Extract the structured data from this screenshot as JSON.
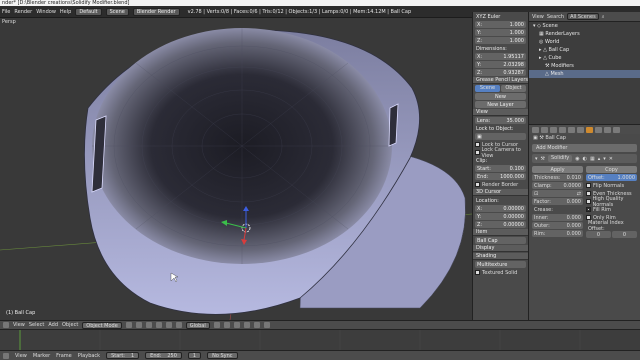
{
  "window": {
    "title": "nder* [D:\\Blender creations\\Solidify Modifier.blend]"
  },
  "infobar": {
    "menus": [
      "File",
      "Render",
      "Window",
      "Help"
    ],
    "layout": "Default",
    "scene": "Scene",
    "engine": "Blender Render",
    "stats": "v2.78 | Verts:0/8 | Faces:0/6 | Tris:0/12 | Objects:1/3 | Lamps:0/0 | Mem:14.12M | Ball Cap"
  },
  "viewport": {
    "label": "Persp",
    "object_name": "(1) Ball Cap"
  },
  "npanel": {
    "xyz_euler": "XYZ Euler",
    "rotation": [
      [
        "X:",
        "1.000"
      ],
      [
        "Y:",
        "1.000"
      ],
      [
        "Z:",
        "1.000"
      ]
    ],
    "dimensions_label": "Dimensions:",
    "dimensions": [
      [
        "X:",
        "1.95117"
      ],
      [
        "Y:",
        "2.03298"
      ],
      [
        "Z:",
        "0.93287"
      ]
    ],
    "grease_pencil": "Grease Pencil Layers",
    "gp_tabs": [
      "Scene",
      "Object"
    ],
    "new_button": "New",
    "new_layer_button": "New Layer",
    "view_header": "View",
    "lens_label": "Lens:",
    "lens_value": "35.000",
    "lock_to_object": "Lock to Object:",
    "lock_to_cursor": "Lock to Cursor",
    "lock_camera": "Lock Camera to View",
    "clip_label": "Clip:",
    "clip_start_label": "Start:",
    "clip_start": "0.100",
    "clip_end_label": "End:",
    "clip_end": "1000.000",
    "render_border": "Render Border",
    "cursor_header": "3D Cursor",
    "location_label": "Location:",
    "cursor": [
      [
        "X:",
        "0.00000"
      ],
      [
        "Y:",
        "0.00000"
      ],
      [
        "Z:",
        "0.00000"
      ]
    ],
    "item_header": "Item",
    "item_name": "Ball Cap",
    "display_header": "Display",
    "shading_header": "Shading",
    "multitexture": "Multitexture",
    "textured_solid": "Textured Solid"
  },
  "outliner": {
    "view": "View",
    "search": "Search",
    "scenes": "All Scenes",
    "items": [
      "Scene",
      "RenderLayers",
      "World",
      "Ball Cap",
      "Cube",
      "Modifiers",
      "Mesh"
    ]
  },
  "properties": {
    "path": "Ball Cap",
    "add_modifier": "Add Modifier",
    "modifier_name": "Solidify",
    "left": {
      "apply": "Apply",
      "thickness_label": "Thickness:",
      "thickness": "0.010",
      "clamp_label": "Clamp:",
      "clamp": "0.0000",
      "offset_label": "Offset:",
      "offset": "1",
      "factor_label": "Factor:",
      "factor": "0.000",
      "crease_label": "Crease:",
      "inner_label": "Inner:",
      "inner": "0.000",
      "outer_label": "Outer:",
      "outer": "0.000",
      "rim_label": "Rim:",
      "rim": "0.000"
    },
    "right": {
      "copy": "Copy",
      "offset_label": "Offset:",
      "offset": "1.0000",
      "flip_normals": "Flip Normals",
      "even_thickness": "Even Thickness",
      "high_quality": "High Quality Normals",
      "fill_rim": "Fill Rim",
      "only_rim": "Only Rim",
      "material_offset": "Material Index Offset:",
      "mat_a": "0",
      "mat_b": "0"
    }
  },
  "vpheader": {
    "menus": [
      "View",
      "Select",
      "Add",
      "Object"
    ],
    "mode": "Object Mode",
    "orientation": "Global"
  },
  "timeline": {
    "menus": [
      "View",
      "Marker",
      "Frame",
      "Playback"
    ],
    "start_label": "Start:",
    "start": "1",
    "end_label": "End:",
    "end": "250",
    "current": "1",
    "sync": "No Sync"
  },
  "colors": {
    "selected": "#5680c2",
    "active_tab": "#cf8a2e",
    "mesh_light": "#b6b9e0",
    "mesh_dark": "#1c1c24",
    "background": "#393939"
  }
}
